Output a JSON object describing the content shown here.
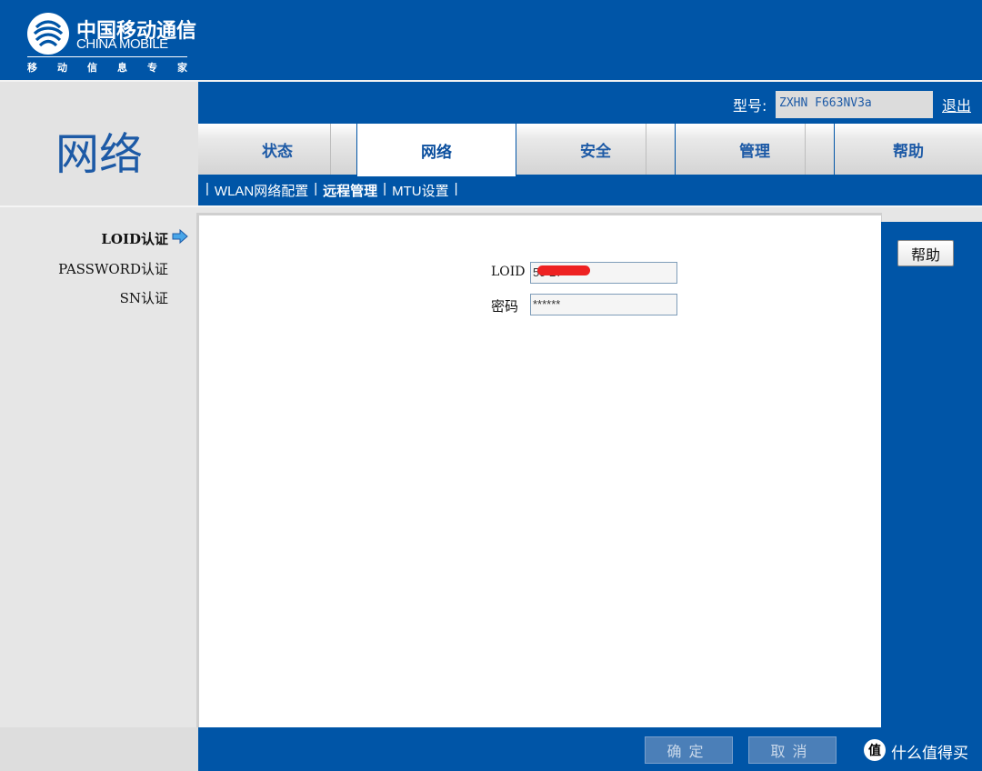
{
  "header": {
    "brand_cn": "中国移动通信",
    "brand_en": "CHINA MOBILE",
    "slogan": [
      "移",
      "动",
      "信",
      "息",
      "专",
      "家"
    ]
  },
  "section": {
    "title": "网络"
  },
  "topbar": {
    "model_label": "型号:",
    "model_value": "ZXHN F663NV3a",
    "logout": "退出"
  },
  "tabs": [
    {
      "label": "状态",
      "active": false
    },
    {
      "label": "网络",
      "active": true
    },
    {
      "label": "安全",
      "active": false
    },
    {
      "label": "管理",
      "active": false
    },
    {
      "label": "帮助",
      "active": false
    }
  ],
  "subnav": {
    "sep": "|",
    "items": [
      "WLAN网络配置",
      "远程管理",
      "MTU设置"
    ]
  },
  "left_menu": {
    "items": [
      "LOID认证",
      "PASSWORD认证",
      "SN认证"
    ]
  },
  "form": {
    "loid_label": "LOID",
    "loid_value": "59        27",
    "password_label": "密码",
    "password_value": "******"
  },
  "help_button": "帮助",
  "footer": {
    "confirm": "确定",
    "cancel": "取消"
  },
  "watermark": {
    "icon": "值",
    "text": "什么值得买"
  },
  "colors": {
    "brand_blue": "#0055a7",
    "text_blue": "#1d5aa6"
  }
}
